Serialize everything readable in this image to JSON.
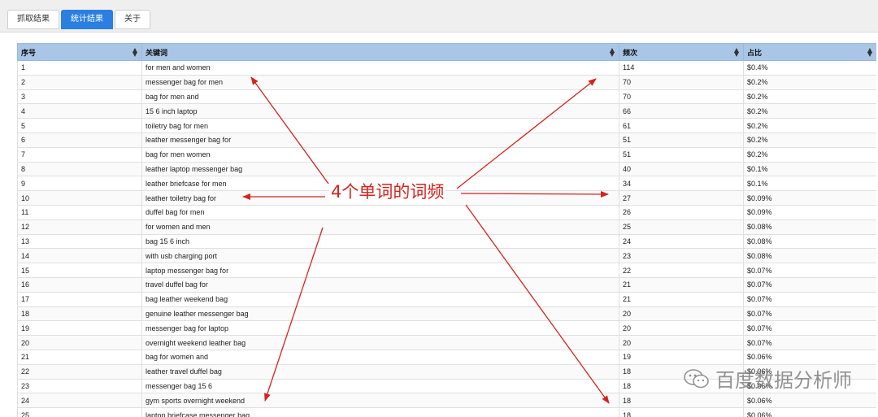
{
  "tabs": [
    {
      "label": "抓取结果",
      "active": false
    },
    {
      "label": "统计结果",
      "active": true
    },
    {
      "label": "关于",
      "active": false
    }
  ],
  "table": {
    "columns": [
      "序号",
      "关键词",
      "频次",
      "占比"
    ],
    "rows": [
      [
        "1",
        "for men and women",
        "114",
        "$0.4%"
      ],
      [
        "2",
        "messenger bag for men",
        "70",
        "$0.2%"
      ],
      [
        "3",
        "bag for men and",
        "70",
        "$0.2%"
      ],
      [
        "4",
        "15 6 inch laptop",
        "66",
        "$0.2%"
      ],
      [
        "5",
        "toiletry bag for men",
        "61",
        "$0.2%"
      ],
      [
        "6",
        "leather messenger bag for",
        "51",
        "$0.2%"
      ],
      [
        "7",
        "bag for men women",
        "51",
        "$0.2%"
      ],
      [
        "8",
        "leather laptop messenger bag",
        "40",
        "$0.1%"
      ],
      [
        "9",
        "leather briefcase for men",
        "34",
        "$0.1%"
      ],
      [
        "10",
        "leather toiletry bag for",
        "27",
        "$0.09%"
      ],
      [
        "11",
        "duffel bag for men",
        "26",
        "$0.09%"
      ],
      [
        "12",
        "for women and men",
        "25",
        "$0.08%"
      ],
      [
        "13",
        "bag 15 6 inch",
        "24",
        "$0.08%"
      ],
      [
        "14",
        "with usb charging port",
        "23",
        "$0.08%"
      ],
      [
        "15",
        "laptop messenger bag for",
        "22",
        "$0.07%"
      ],
      [
        "16",
        "travel duffel bag for",
        "21",
        "$0.07%"
      ],
      [
        "17",
        "bag leather weekend bag",
        "21",
        "$0.07%"
      ],
      [
        "18",
        "genuine leather messenger bag",
        "20",
        "$0.07%"
      ],
      [
        "19",
        "messenger bag for laptop",
        "20",
        "$0.07%"
      ],
      [
        "20",
        "overnight weekend leather bag",
        "20",
        "$0.07%"
      ],
      [
        "21",
        "bag for women and",
        "19",
        "$0.06%"
      ],
      [
        "22",
        "leather travel duffel bag",
        "18",
        "$0.06%"
      ],
      [
        "23",
        "messenger bag 15 6",
        "18",
        "$0.06%"
      ],
      [
        "24",
        "gym sports overnight weekend",
        "18",
        "$0.06%"
      ],
      [
        "25",
        "laptop briefcase messenger bag",
        "18",
        "$0.06%"
      ]
    ]
  },
  "annotation": {
    "text": "4个单词的词频",
    "color": "#d4241f"
  },
  "watermark": {
    "text": "百度数据分析师",
    "icon": "wechat-icon"
  },
  "colors": {
    "header_bg": "#a9c6e6",
    "active_tab": "#2b7fe0",
    "arrow": "#d4241f"
  }
}
